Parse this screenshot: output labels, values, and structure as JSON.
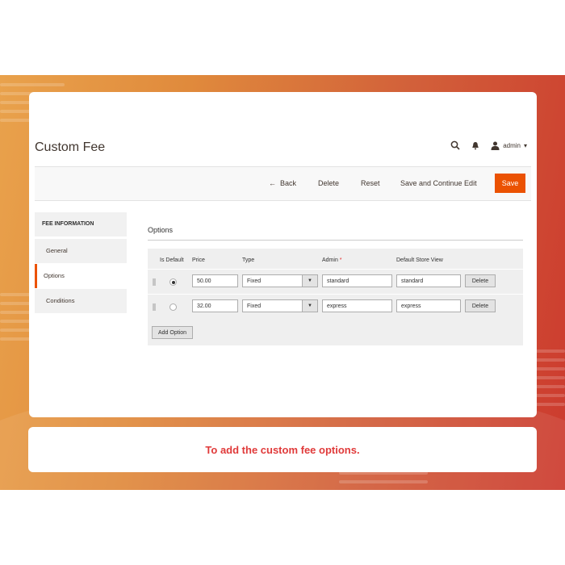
{
  "header": {
    "title": "Custom Fee",
    "user_name": "admin",
    "user_caret": "▾"
  },
  "toolbar": {
    "back_arrow": "←",
    "back_label": "Back",
    "delete_label": "Delete",
    "reset_label": "Reset",
    "save_continue_label": "Save and Continue Edit",
    "save_label": "Save"
  },
  "sidebar": {
    "heading": "FEE INFORMATION",
    "items": [
      {
        "label": "General",
        "active": false
      },
      {
        "label": "Options",
        "active": true
      },
      {
        "label": "Conditions",
        "active": false
      }
    ]
  },
  "options": {
    "title": "Options",
    "columns": {
      "is_default": "Is Default",
      "price": "Price",
      "type": "Type",
      "admin": "Admin",
      "required_mark": "*",
      "store_view": "Default Store View"
    },
    "rows": [
      {
        "is_default": true,
        "price": "50.00",
        "type": "Fixed",
        "admin": "standard",
        "store_view": "standard",
        "delete_label": "Delete"
      },
      {
        "is_default": false,
        "price": "32.00",
        "type": "Fixed",
        "admin": "express",
        "store_view": "express",
        "delete_label": "Delete"
      }
    ],
    "add_label": "Add Option"
  },
  "caption": "To add the custom fee options.",
  "colors": {
    "accent": "#eb5202",
    "caption_text": "#e03a3a",
    "required": "#e22626"
  },
  "icons": [
    "search-icon",
    "bell-icon",
    "user-icon",
    "arrow-left-icon",
    "chevron-down-icon",
    "drag-handle-icon"
  ]
}
